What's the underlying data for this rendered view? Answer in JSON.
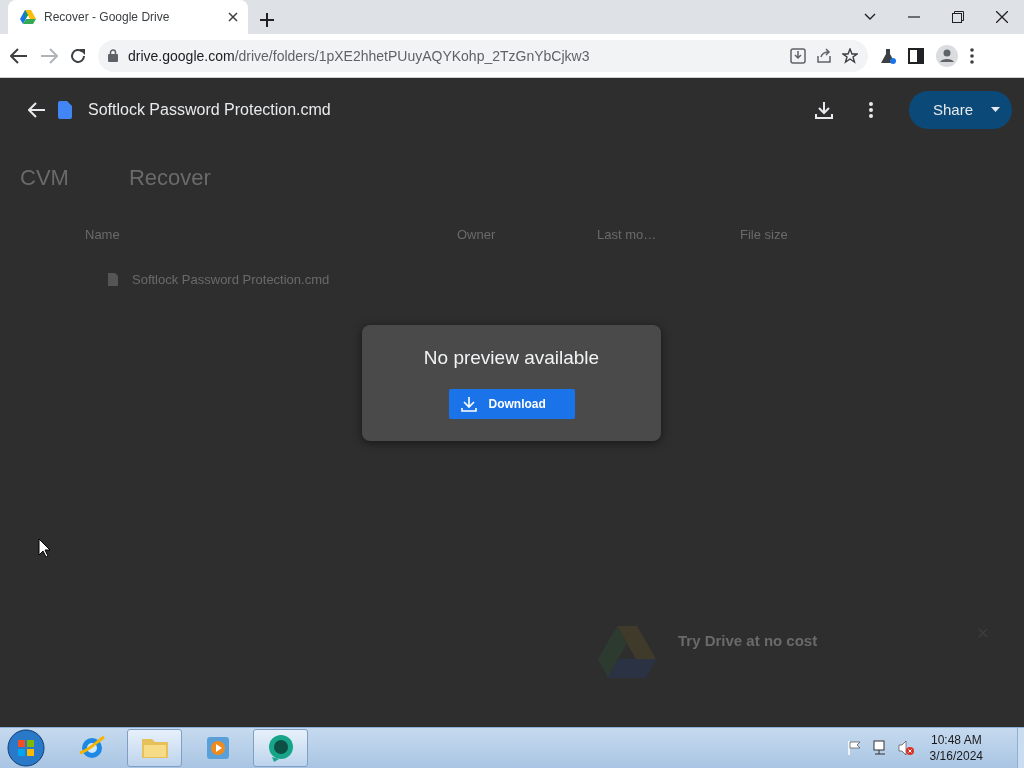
{
  "browser": {
    "tab": {
      "title": "Recover - Google Drive",
      "selected": true
    },
    "url": {
      "host": "drive.google.com",
      "path": "/drive/folders/1pXE2hhetPUuyAQYKohp_2TzGnYbCjkw3"
    }
  },
  "viewer": {
    "file_name": "Softlock Password Protection.cmd",
    "share_button": "Share"
  },
  "background": {
    "breadcrumb": [
      "CVM",
      "Recover"
    ],
    "columns": [
      "Name",
      "Owner",
      "Last mo…",
      "File size"
    ],
    "row": {
      "name": "Softlock Password Protection.cmd"
    },
    "promo": {
      "title": "Try Drive at no cost"
    }
  },
  "dialog": {
    "message": "No preview available",
    "button": "Download"
  },
  "taskbar": {
    "apps": [
      {
        "kind": "browser",
        "running": false
      },
      {
        "kind": "folder",
        "running": true
      },
      {
        "kind": "media",
        "running": false
      },
      {
        "kind": "chat",
        "running": true
      }
    ],
    "time": "10:48 AM",
    "date": "3/16/2024"
  }
}
